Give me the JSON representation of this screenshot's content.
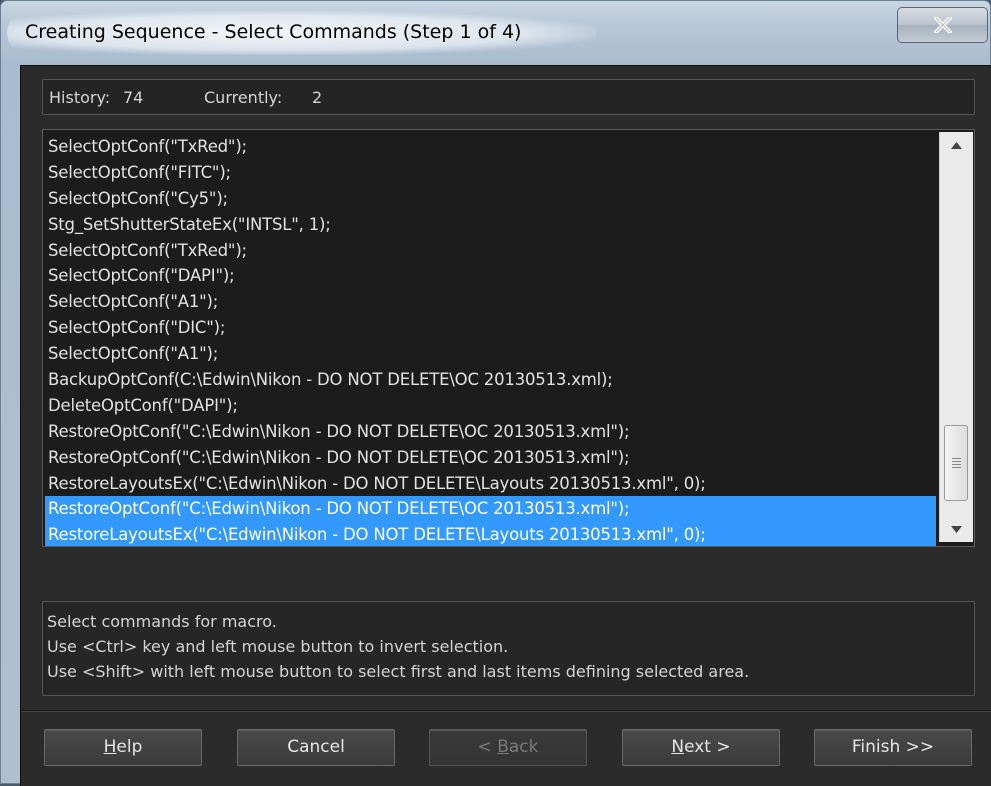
{
  "window": {
    "title": "Creating Sequence - Select Commands  (Step 1 of 4)"
  },
  "history": {
    "history_label": "History:",
    "history_value": "74",
    "currently_label": "Currently:",
    "currently_value": "2"
  },
  "commands": [
    {
      "text": "SelectOptConf(\"TxRed\");",
      "selected": false
    },
    {
      "text": "SelectOptConf(\"FITC\");",
      "selected": false
    },
    {
      "text": "SelectOptConf(\"Cy5\");",
      "selected": false
    },
    {
      "text": "Stg_SetShutterStateEx(\"INTSL\", 1);",
      "selected": false
    },
    {
      "text": "SelectOptConf(\"TxRed\");",
      "selected": false
    },
    {
      "text": "SelectOptConf(\"DAPI\");",
      "selected": false
    },
    {
      "text": "SelectOptConf(\"A1\");",
      "selected": false
    },
    {
      "text": "SelectOptConf(\"DIC\");",
      "selected": false
    },
    {
      "text": "SelectOptConf(\"A1\");",
      "selected": false
    },
    {
      "text": "BackupOptConf(C:\\Edwin\\Nikon - DO NOT DELETE\\OC 20130513.xml);",
      "selected": false
    },
    {
      "text": "DeleteOptConf(\"DAPI\");",
      "selected": false
    },
    {
      "text": "RestoreOptConf(\"C:\\Edwin\\Nikon - DO NOT DELETE\\OC 20130513.xml\");",
      "selected": false
    },
    {
      "text": "RestoreOptConf(\"C:\\Edwin\\Nikon - DO NOT DELETE\\OC 20130513.xml\");",
      "selected": false
    },
    {
      "text": "RestoreLayoutsEx(\"C:\\Edwin\\Nikon - DO NOT DELETE\\Layouts 20130513.xml\", 0);",
      "selected": false
    },
    {
      "text": "RestoreOptConf(\"C:\\Edwin\\Nikon - DO NOT DELETE\\OC 20130513.xml\");",
      "selected": true
    },
    {
      "text": "RestoreLayoutsEx(\"C:\\Edwin\\Nikon - DO NOT DELETE\\Layouts 20130513.xml\", 0);",
      "selected": true
    }
  ],
  "info": {
    "lines": [
      "Select commands for macro.",
      "Use <Ctrl> key and left mouse button to invert selection.",
      "Use <Shift> with left mouse button to select first and last items defining selected area."
    ]
  },
  "buttons": {
    "help": {
      "prefix": "",
      "mnemonic": "H",
      "rest": "elp",
      "enabled": true
    },
    "cancel": {
      "prefix": "",
      "mnemonic": "",
      "rest": "Cancel",
      "enabled": true
    },
    "back": {
      "prefix": "< ",
      "mnemonic": "B",
      "rest": "ack",
      "enabled": false
    },
    "next": {
      "prefix": "",
      "mnemonic": "N",
      "rest": "ext >",
      "enabled": true
    },
    "finish": {
      "prefix": "",
      "mnemonic": "",
      "rest": "Finish >>",
      "enabled": true
    }
  },
  "colors": {
    "selection": "#3399ff",
    "client_bg": "#2b2b2b",
    "list_bg": "#1c1c1c"
  }
}
